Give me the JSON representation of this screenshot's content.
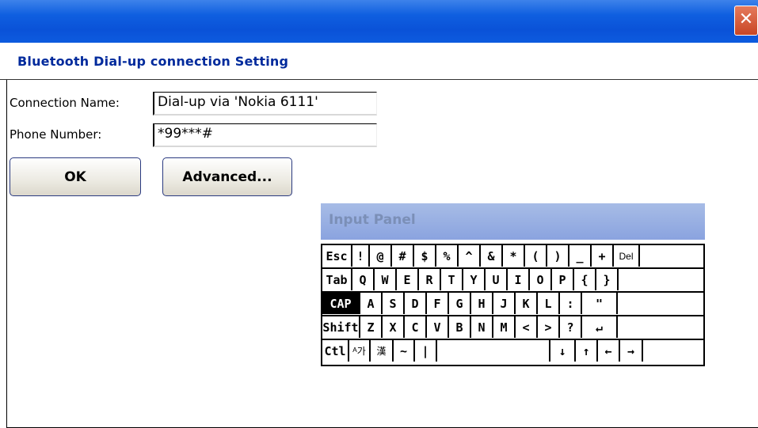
{
  "window": {
    "close_glyph": "✕"
  },
  "header": {
    "title": "Bluetooth Dial-up connection Setting"
  },
  "form": {
    "connection_name_label": "Connection Name:",
    "connection_name_value": "Dial-up via 'Nokia 6111'",
    "phone_label": "Phone Number:",
    "phone_value": "*99***#"
  },
  "buttons": {
    "ok": "OK",
    "advanced": "Advanced..."
  },
  "input_panel": {
    "title": "Input Panel",
    "rows": [
      [
        "Esc",
        "!",
        "@",
        "#",
        "$",
        "%",
        "^",
        "&",
        "*",
        "(",
        ")",
        "_",
        "+",
        "Del"
      ],
      [
        "Tab",
        "Q",
        "W",
        "E",
        "R",
        "T",
        "Y",
        "U",
        "I",
        "O",
        "P",
        "{",
        "}"
      ],
      [
        "CAP",
        "A",
        "S",
        "D",
        "F",
        "G",
        "H",
        "J",
        "K",
        "L",
        ":",
        "\""
      ],
      [
        "Shift",
        "Z",
        "X",
        "C",
        "V",
        "B",
        "N",
        "M",
        "<",
        ">",
        "?",
        "↵"
      ],
      [
        "Ctl",
        "ᴬ가",
        "漢",
        "~",
        "|",
        "",
        "↓",
        "↑",
        "←",
        "→"
      ]
    ]
  },
  "colors": {
    "title_blue": "#0a52d8",
    "header_text": "#002a9c",
    "close_red": "#d65a3a"
  }
}
